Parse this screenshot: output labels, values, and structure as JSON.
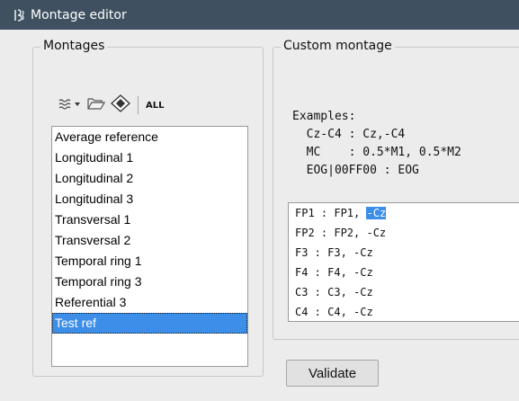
{
  "window": {
    "title": "Montage editor"
  },
  "montages": {
    "group_title": "Montages",
    "toolbar": {
      "menu_icon": "waves-dropdown-icon",
      "open_icon": "folder-open-icon",
      "save_icon": "diamond-save-icon",
      "all_label": "ALL"
    },
    "items": [
      "Average reference",
      "Longitudinal 1",
      "Longitudinal 2",
      "Longitudinal 3",
      "Transversal 1",
      "Transversal 2",
      "Temporal ring 1",
      "Temporal ring 3",
      "Referential 3",
      "Test ref"
    ],
    "selected": "Test ref"
  },
  "custom": {
    "group_title": "Custom montage",
    "examples": {
      "heading": "Examples:",
      "line1": "  Cz-C4 : Cz,-C4",
      "line2": "  MC    : 0.5*M1, 0.5*M2",
      "line3": "  EOG|00FF00 : EOG"
    },
    "editor_lines": [
      {
        "text": "FP1 : FP1, ",
        "selected": "-Cz"
      },
      {
        "text": "FP2 : FP2, -Cz",
        "selected": ""
      },
      {
        "text": "F3 : F3, -Cz",
        "selected": ""
      },
      {
        "text": "F4 : F4, -Cz",
        "selected": ""
      },
      {
        "text": "C3 : C3, -Cz",
        "selected": ""
      },
      {
        "text": "C4 : C4, -Cz",
        "selected": ""
      }
    ]
  },
  "validate_label": "Validate",
  "colors": {
    "titlebar": "#3f5160",
    "selection": "#3c8ee8"
  }
}
